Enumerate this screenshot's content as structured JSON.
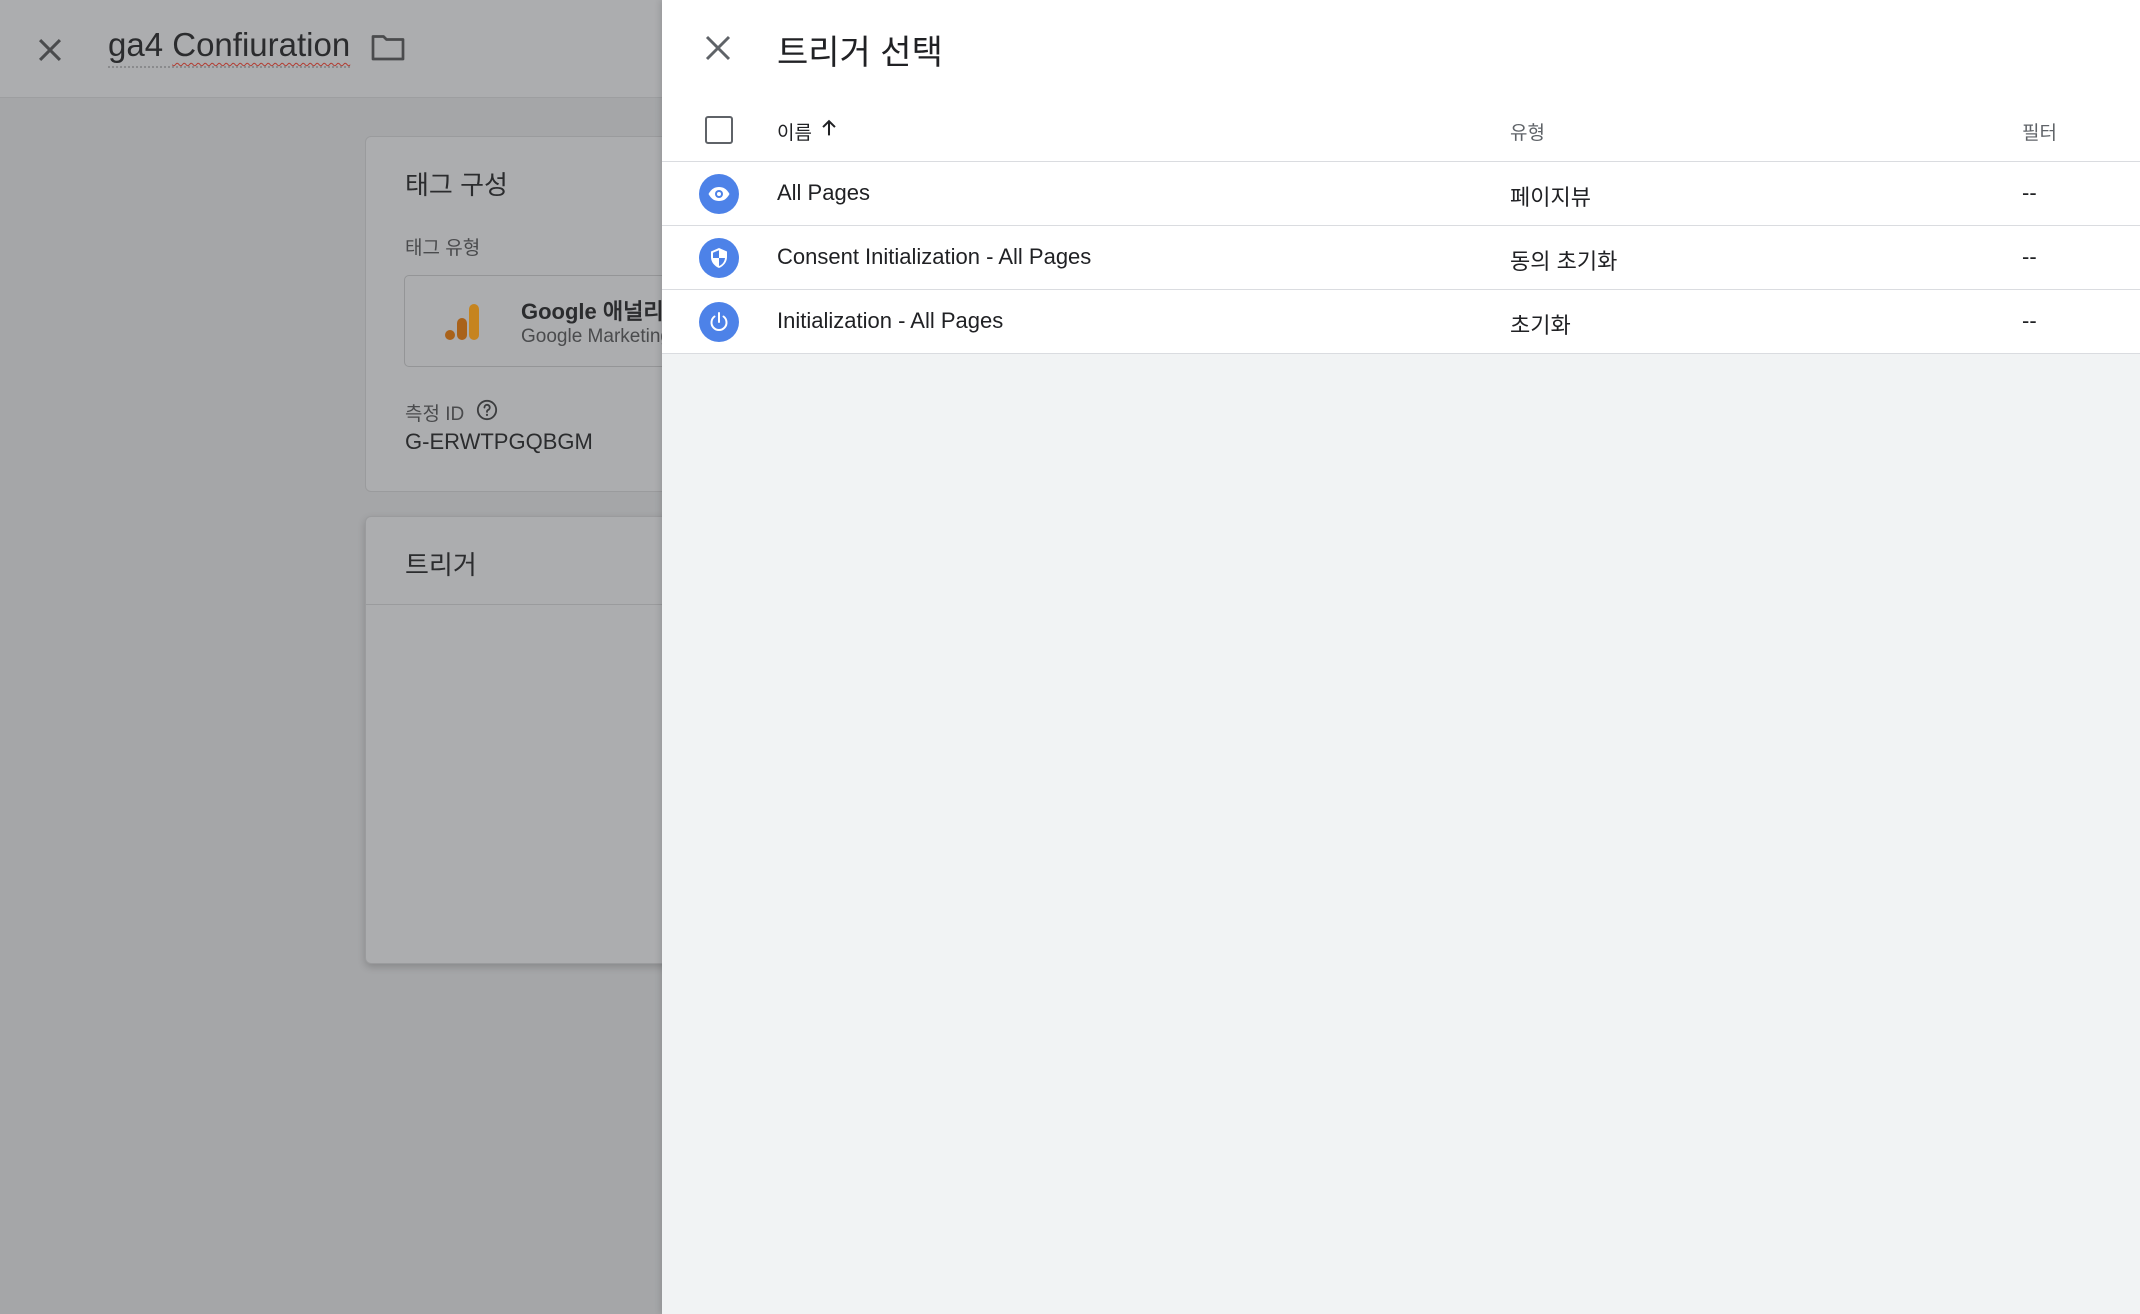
{
  "background": {
    "title_part1": "ga4 ",
    "title_part2": "Confiuration",
    "config_card": {
      "title": "태그 구성",
      "tag_type_label": "태그 유형",
      "tag_type_name": "Google 애널리틱",
      "tag_type_sub": "Google Marketing",
      "measurement_label": "측정 ID",
      "measurement_value": "G-ERWTPGQBGM"
    },
    "trigger_card": {
      "title": "트리거"
    }
  },
  "panel": {
    "title": "트리거 선택",
    "columns": {
      "name": "이름",
      "type": "유형",
      "filter": "필터"
    },
    "rows": [
      {
        "icon": "eye-icon",
        "name": "All Pages",
        "type": "페이지뷰",
        "filter": "--"
      },
      {
        "icon": "shield-icon",
        "name": "Consent Initialization - All Pages",
        "type": "동의 초기화",
        "filter": "--"
      },
      {
        "icon": "power-icon",
        "name": "Initialization - All Pages",
        "type": "초기화",
        "filter": "--"
      }
    ]
  },
  "colors": {
    "accent_blue": "#4d82e8",
    "analytics_orange": "#c67a1c"
  }
}
